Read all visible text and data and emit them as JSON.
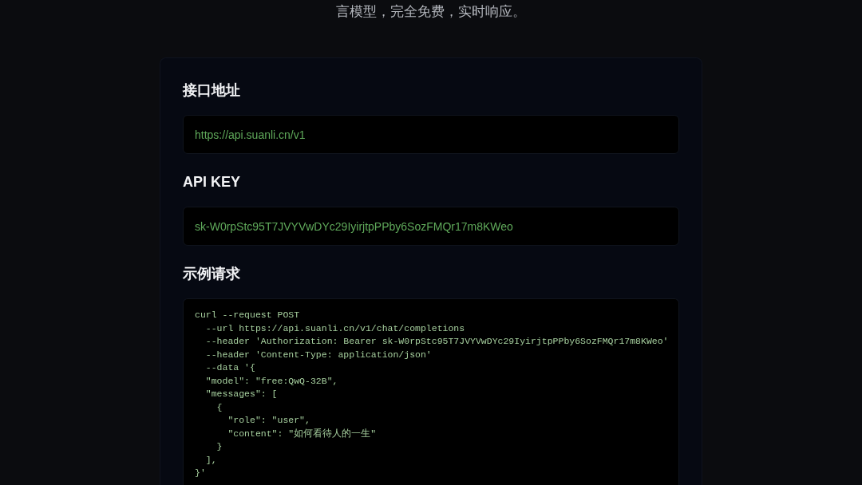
{
  "intro": {
    "text": "言模型，完全免费，实时响应。"
  },
  "sections": [
    {
      "kind": "field",
      "heading": "接口地址",
      "value": "https://api.suanli.cn/v1"
    },
    {
      "kind": "field",
      "heading": "API KEY",
      "value": "sk-W0rpStc95T7JVYVwDYc29IyirjtpPPby6SozFMQr17m8KWeo"
    },
    {
      "kind": "code",
      "heading": "示例请求",
      "code_lines": [
        "curl --request POST",
        "  --url https://api.suanli.cn/v1/chat/completions",
        "  --header 'Authorization: Bearer sk-W0rpStc95T7JVYVwDYc29IyirjtpPPby6SozFMQr17m8KWeo'",
        "  --header 'Content-Type: application/json'",
        "  --data '{",
        "  \"model\": \"free:QwQ-32B\",",
        "  \"messages\": [",
        "    {",
        "      \"role\": \"user\",",
        "      \"content\": \"如何看待人的一生\"",
        "    }",
        "  ],",
        "}'"
      ]
    }
  ]
}
